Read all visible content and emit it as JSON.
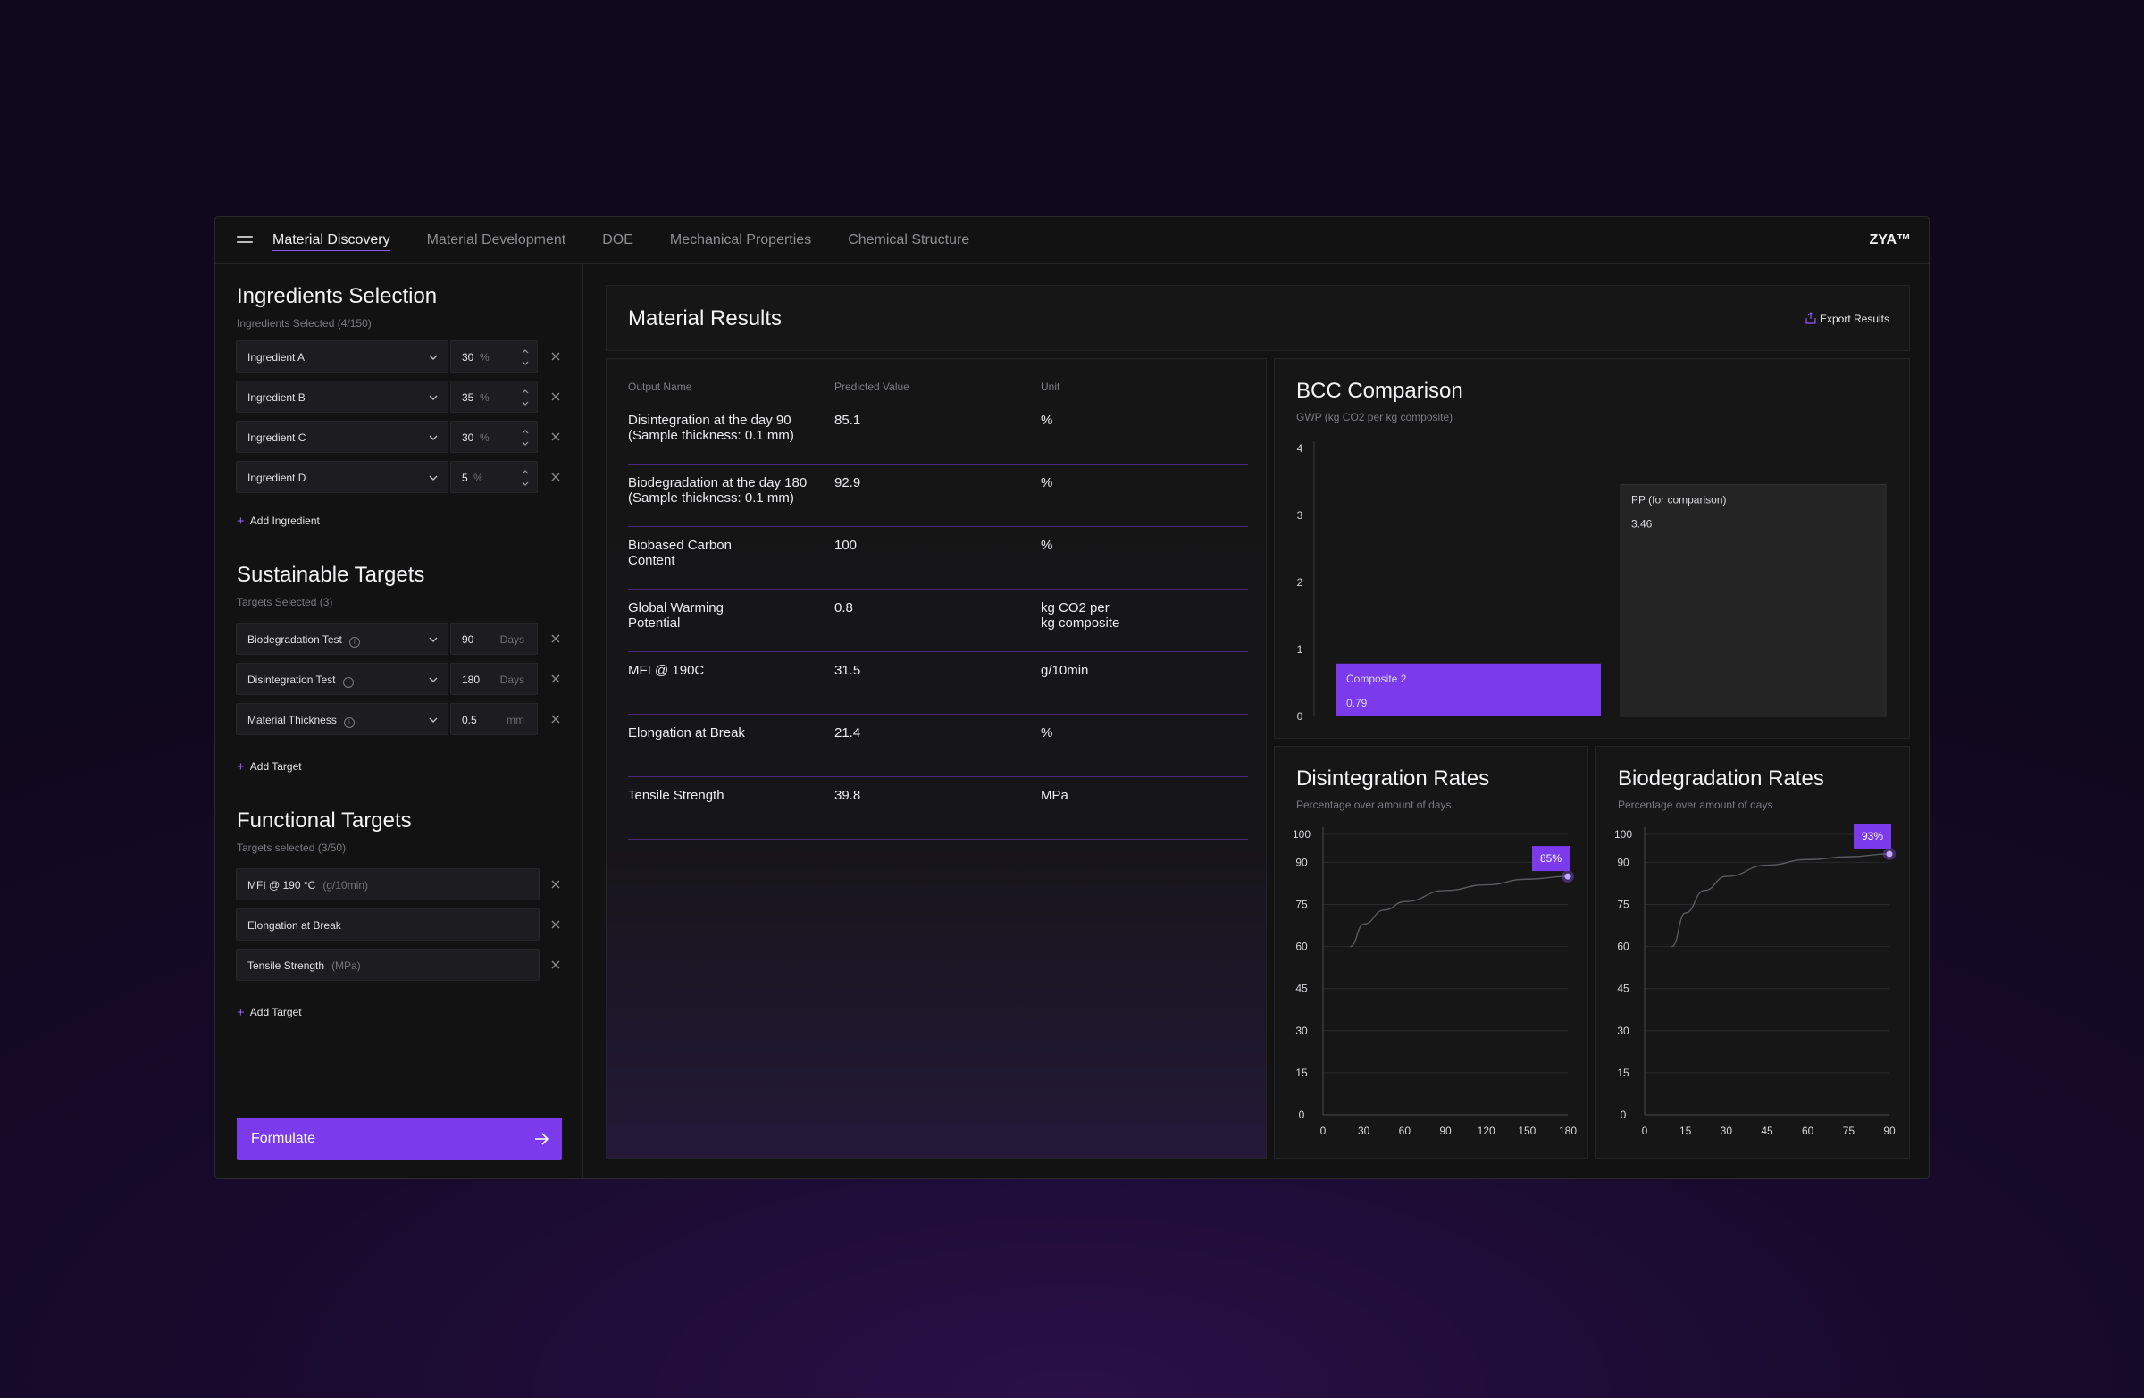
{
  "nav": {
    "tabs": [
      {
        "label": "Material Discovery",
        "active": true
      },
      {
        "label": "Material Development",
        "active": false
      },
      {
        "label": "DOE",
        "active": false
      },
      {
        "label": "Mechanical Properties",
        "active": false
      },
      {
        "label": "Chemical Structure",
        "active": false
      }
    ],
    "brand": "ZYA™"
  },
  "ingredients": {
    "title": "Ingredients Selection",
    "subtitle": "Ingredients Selected (4/150)",
    "items": [
      {
        "name": "Ingredient A",
        "value": "30",
        "unit": "%"
      },
      {
        "name": "Ingredient B",
        "value": "35",
        "unit": "%"
      },
      {
        "name": "Ingredient C",
        "value": "30",
        "unit": "%"
      },
      {
        "name": "Ingredient D",
        "value": "5",
        "unit": "%"
      }
    ],
    "add_label": "Add Ingredient"
  },
  "sustainable": {
    "title": "Sustainable Targets",
    "subtitle": "Targets Selected (3)",
    "items": [
      {
        "name": "Biodegradation Test",
        "value": "90",
        "unit": "Days"
      },
      {
        "name": "Disintegration Test",
        "value": "180",
        "unit": "Days"
      },
      {
        "name": "Material Thickness",
        "value": "0.5",
        "unit": "mm"
      }
    ],
    "add_label": "Add Target"
  },
  "functional": {
    "title": "Functional Targets",
    "subtitle": "Targets selected (3/50)",
    "items": [
      {
        "name": "MFI @ 190 °C",
        "unit": "(g/10min)"
      },
      {
        "name": "Elongation at Break",
        "unit": ""
      },
      {
        "name": "Tensile Strength",
        "unit": "(MPa)"
      }
    ],
    "add_label": "Add Target"
  },
  "formulate_label": "Formulate",
  "results": {
    "title": "Material Results",
    "export_label": "Export Results",
    "columns": [
      "Output Name",
      "Predicted Value",
      "Unit"
    ],
    "rows": [
      {
        "name": "Disintegration at the day 90\n(Sample thickness: 0.1 mm)",
        "value": "85.1",
        "unit": "%"
      },
      {
        "name": "Biodegradation at the day 180\n(Sample thickness: 0.1 mm)",
        "value": "92.9",
        "unit": "%"
      },
      {
        "name": "Biobased Carbon\nContent",
        "value": "100",
        "unit": "%"
      },
      {
        "name": "Global Warming\nPotential",
        "value": "0.8",
        "unit": "kg CO2 per\nkg composite"
      },
      {
        "name": "MFI @ 190C",
        "value": "31.5",
        "unit": "g/10min"
      },
      {
        "name": "Elongation at Break",
        "value": "21.4",
        "unit": "%"
      },
      {
        "name": "Tensile Strength",
        "value": "39.8",
        "unit": "MPa"
      }
    ]
  },
  "colors": {
    "accent": "#7c3aed",
    "accent_light": "#8b5cf6",
    "grid": "#2a2a2a"
  },
  "chart_data": [
    {
      "type": "bar",
      "title": "BCC Comparison",
      "subtitle": "GWP (kg CO2 per kg composite)",
      "categories": [
        "Composite 2",
        "PP (for comparison)"
      ],
      "values": [
        0.79,
        3.46
      ],
      "value_labels": [
        "0.79",
        "3.46"
      ],
      "bar_colors": [
        "#7c3aed",
        "#242424"
      ],
      "ylim": [
        0,
        4
      ],
      "yticks": [
        "0",
        "1",
        "2",
        "3",
        "4"
      ]
    },
    {
      "type": "line",
      "title": "Disintegration Rates",
      "subtitle": "Percentage over amount of days",
      "x": [
        20,
        30,
        45,
        60,
        90,
        120,
        150,
        180
      ],
      "values": [
        60,
        68,
        73,
        76,
        80,
        82,
        84,
        85
      ],
      "end_label": "85%",
      "xlim": [
        0,
        180
      ],
      "ylim": [
        0,
        100
      ],
      "xticks": [
        "0",
        "30",
        "60",
        "90",
        "120",
        "150",
        "180"
      ],
      "yticks": [
        "0",
        "15",
        "30",
        "45",
        "60",
        "75",
        "90",
        "100"
      ]
    },
    {
      "type": "line",
      "title": "Biodegradation Rates",
      "subtitle": "Percentage over amount of days",
      "x": [
        10,
        15,
        22,
        30,
        45,
        60,
        75,
        90
      ],
      "values": [
        60,
        72,
        80,
        85,
        89,
        91,
        92,
        93
      ],
      "end_label": "93%",
      "xlim": [
        0,
        90
      ],
      "ylim": [
        0,
        100
      ],
      "xticks": [
        "0",
        "15",
        "30",
        "45",
        "60",
        "75",
        "90"
      ],
      "yticks": [
        "0",
        "15",
        "30",
        "45",
        "60",
        "75",
        "90",
        "100"
      ]
    }
  ]
}
